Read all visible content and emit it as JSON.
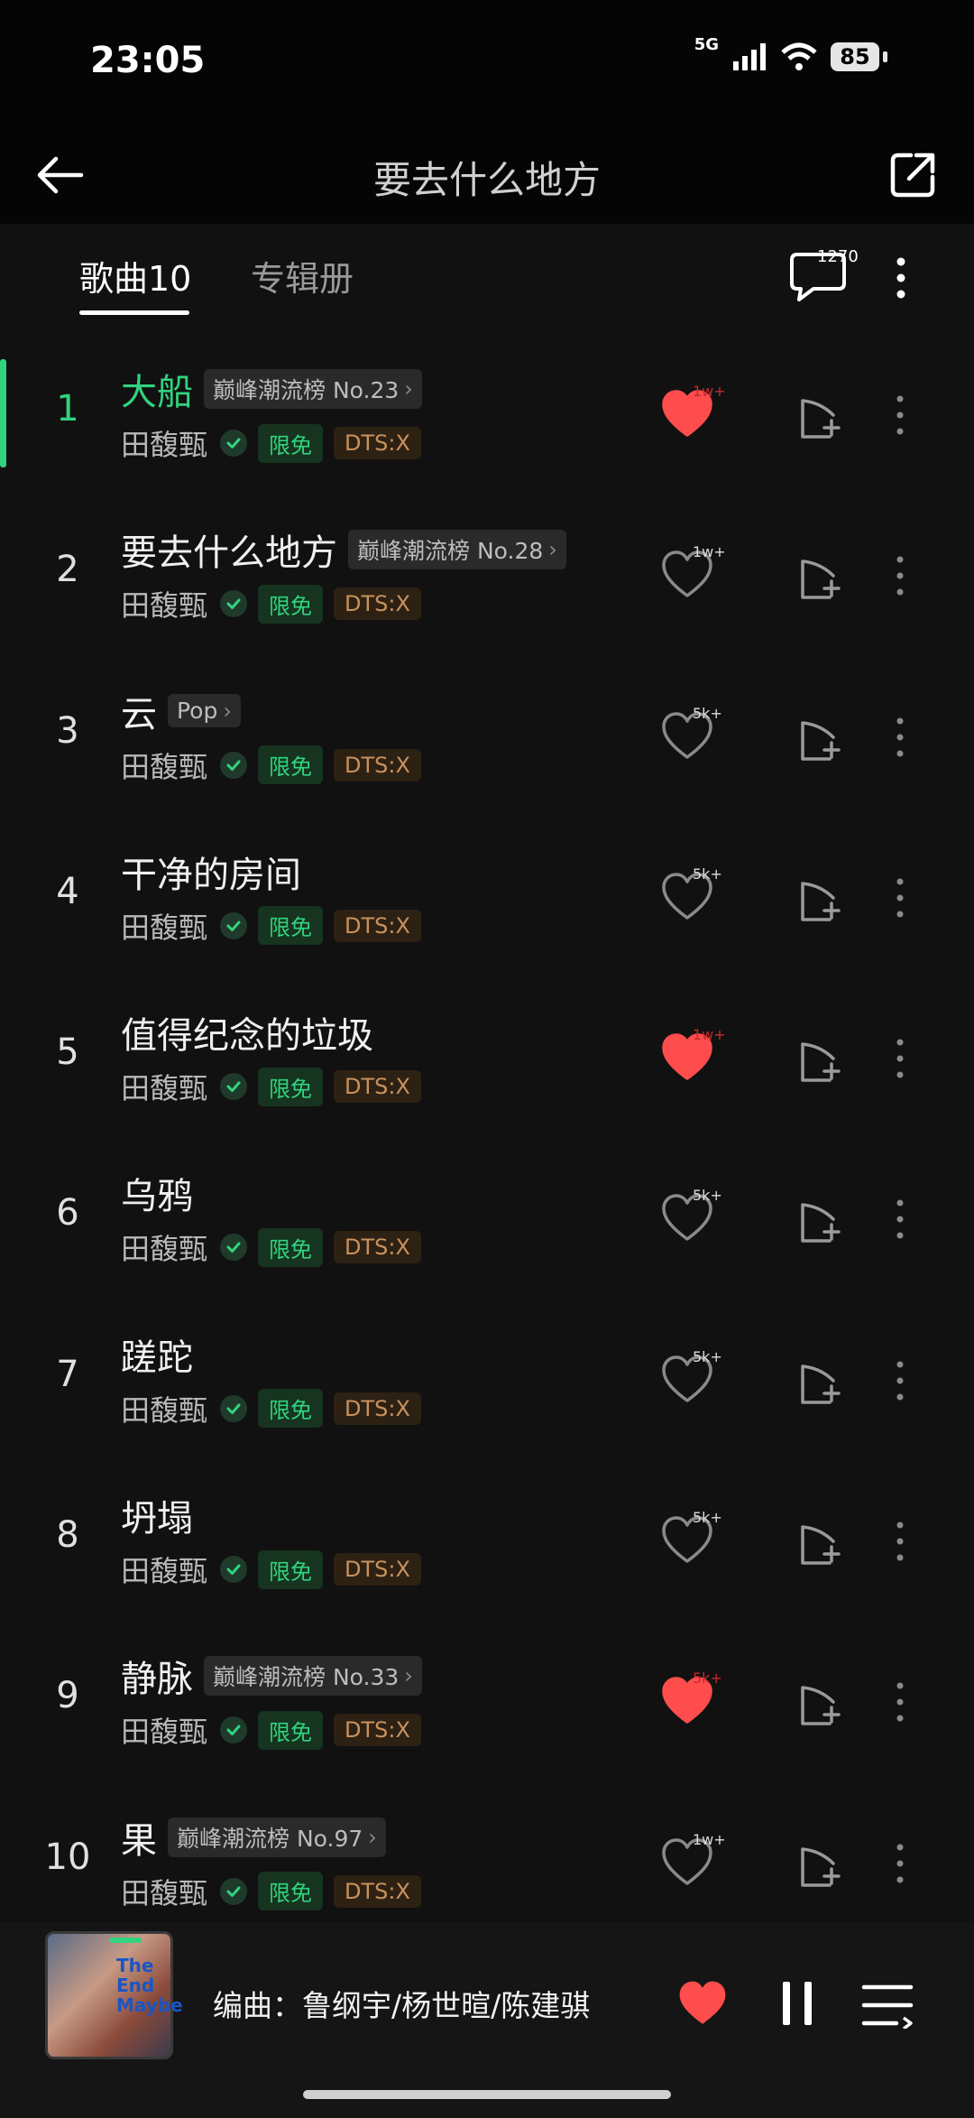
{
  "status": {
    "time": "23:05",
    "network": "5G",
    "battery": "85"
  },
  "header": {
    "title": "要去什么地方"
  },
  "tabs": {
    "songs": "歌曲10",
    "albums": "专辑册",
    "comment_count": "1270"
  },
  "colors": {
    "accent": "#31d37f",
    "liked": "#ff4d4d",
    "background": "#111111"
  },
  "songs": [
    {
      "rank": "1",
      "title": "大船",
      "tag": "巅峰潮流榜 No.23",
      "artist": "田馥甄",
      "free": "限免",
      "dts": "DTS:X",
      "likes": "1w+",
      "liked": true,
      "active": true
    },
    {
      "rank": "2",
      "title": "要去什么地方",
      "tag": "巅峰潮流榜 No.28",
      "artist": "田馥甄",
      "free": "限免",
      "dts": "DTS:X",
      "likes": "1w+",
      "liked": false,
      "active": false
    },
    {
      "rank": "3",
      "title": "云",
      "tag": "Pop",
      "artist": "田馥甄",
      "free": "限免",
      "dts": "DTS:X",
      "likes": "5k+",
      "liked": false,
      "active": false
    },
    {
      "rank": "4",
      "title": "干净的房间",
      "tag": "",
      "artist": "田馥甄",
      "free": "限免",
      "dts": "DTS:X",
      "likes": "5k+",
      "liked": false,
      "active": false
    },
    {
      "rank": "5",
      "title": "值得纪念的垃圾",
      "tag": "",
      "artist": "田馥甄",
      "free": "限免",
      "dts": "DTS:X",
      "likes": "1w+",
      "liked": true,
      "active": false
    },
    {
      "rank": "6",
      "title": "乌鸦",
      "tag": "",
      "artist": "田馥甄",
      "free": "限免",
      "dts": "DTS:X",
      "likes": "5k+",
      "liked": false,
      "active": false
    },
    {
      "rank": "7",
      "title": "蹉跎",
      "tag": "",
      "artist": "田馥甄",
      "free": "限免",
      "dts": "DTS:X",
      "likes": "5k+",
      "liked": false,
      "active": false
    },
    {
      "rank": "8",
      "title": "坍塌",
      "tag": "",
      "artist": "田馥甄",
      "free": "限免",
      "dts": "DTS:X",
      "likes": "5k+",
      "liked": false,
      "active": false
    },
    {
      "rank": "9",
      "title": "静脉",
      "tag": "巅峰潮流榜 No.33",
      "artist": "田馥甄",
      "free": "限免",
      "dts": "DTS:X",
      "likes": "5k+",
      "liked": true,
      "active": false
    },
    {
      "rank": "10",
      "title": "果",
      "tag": "巅峰潮流榜 No.97",
      "artist": "田馥甄",
      "free": "限免",
      "dts": "DTS:X",
      "likes": "1w+",
      "liked": false,
      "active": false
    }
  ],
  "now_playing": {
    "text": "编曲：鲁纲宇/杨世暄/陈建骐",
    "cover_text": "The End Maybe",
    "liked": true
  }
}
